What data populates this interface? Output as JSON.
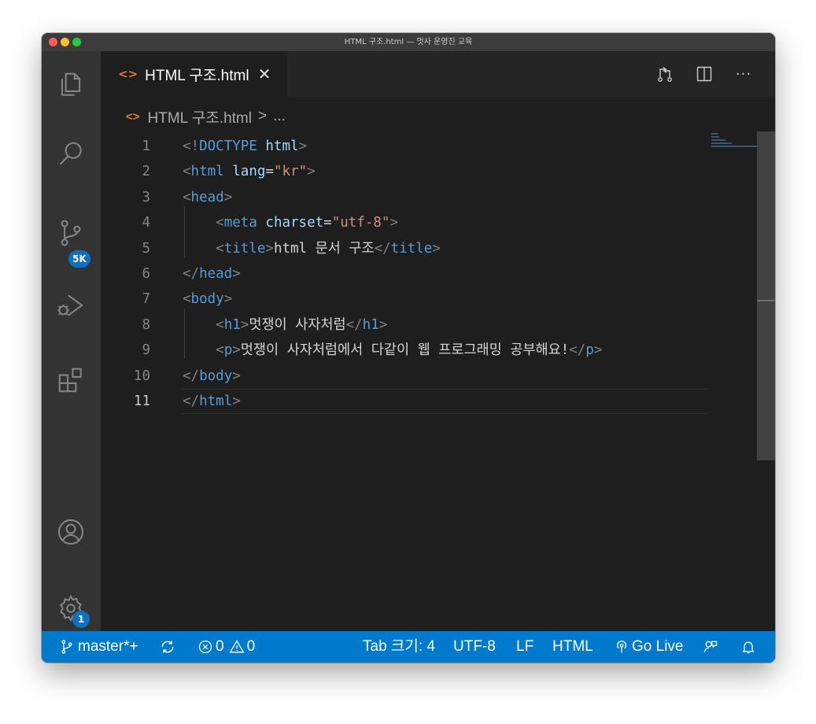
{
  "window": {
    "title": "HTML 구조.html — 멋사 운영진 교육"
  },
  "activity_bar": {
    "source_control_badge": "5K",
    "settings_badge": "1"
  },
  "tab": {
    "label": "HTML 구조.html",
    "close_glyph": "✕",
    "icon_glyph": "<>"
  },
  "tab_actions": {
    "more_glyph": "···"
  },
  "breadcrumb": {
    "icon_glyph": "<>",
    "file": "HTML 구조.html",
    "separator": ">",
    "rest": "..."
  },
  "editor": {
    "current_line": 11,
    "line_numbers": [
      "1",
      "2",
      "3",
      "4",
      "5",
      "6",
      "7",
      "8",
      "9",
      "10",
      "11"
    ],
    "lines": [
      [
        "<!",
        "DOCTYPE",
        " ",
        "html",
        ">"
      ],
      [
        "<",
        "html",
        " ",
        "lang",
        "=",
        "\"kr\"",
        ">"
      ],
      [
        "<",
        "head",
        ">"
      ],
      [
        "    ",
        "<",
        "meta",
        " ",
        "charset",
        "=",
        "\"utf-8\"",
        ">"
      ],
      [
        "    ",
        "<",
        "title",
        ">",
        "html 문서 구조",
        "</",
        "title",
        ">"
      ],
      [
        "</",
        "head",
        ">"
      ],
      [
        "<",
        "body",
        ">"
      ],
      [
        "    ",
        "<",
        "h1",
        ">",
        "멋쟁이 사자처럼",
        "</",
        "h1",
        ">"
      ],
      [
        "    ",
        "<",
        "p",
        ">",
        "멋쟁이 사자처럼에서 다같이 웹 프로그래밍 공부해요!",
        "</",
        "p",
        ">"
      ],
      [
        "</",
        "body",
        ">"
      ],
      [
        "</",
        "html",
        ">"
      ]
    ],
    "token_types": [
      [
        "pn",
        "tag",
        "txt",
        "attr",
        "pn"
      ],
      [
        "pn",
        "tag",
        "txt",
        "attr",
        "txt",
        "str",
        "pn"
      ],
      [
        "pn",
        "tag",
        "pn"
      ],
      [
        "txt",
        "pn",
        "tag",
        "txt",
        "attr",
        "txt",
        "str",
        "pn"
      ],
      [
        "txt",
        "pn",
        "tag",
        "pn",
        "txt",
        "pn",
        "tag",
        "pn"
      ],
      [
        "pn",
        "tag",
        "pn"
      ],
      [
        "pn",
        "tag",
        "pn"
      ],
      [
        "txt",
        "pn",
        "tag",
        "pn",
        "txt",
        "pn",
        "tag",
        "pn"
      ],
      [
        "txt",
        "pn",
        "tag",
        "pn",
        "txt",
        "pn",
        "tag",
        "pn"
      ],
      [
        "pn",
        "tag",
        "pn"
      ],
      [
        "pn",
        "tag",
        "pn"
      ]
    ]
  },
  "status_bar": {
    "branch": "master*+",
    "errors": "0",
    "warnings": "0",
    "indent": "Tab 크기: 4",
    "encoding": "UTF-8",
    "eol": "LF",
    "language": "HTML",
    "go_live": "Go Live"
  },
  "colors": {
    "statusbar": "#007acc",
    "tag": "#569cd6",
    "attribute": "#9cdcfe",
    "string": "#ce9178",
    "punctuation": "#808080",
    "file_icon": "#e37933",
    "badge": "#0e70c0"
  }
}
